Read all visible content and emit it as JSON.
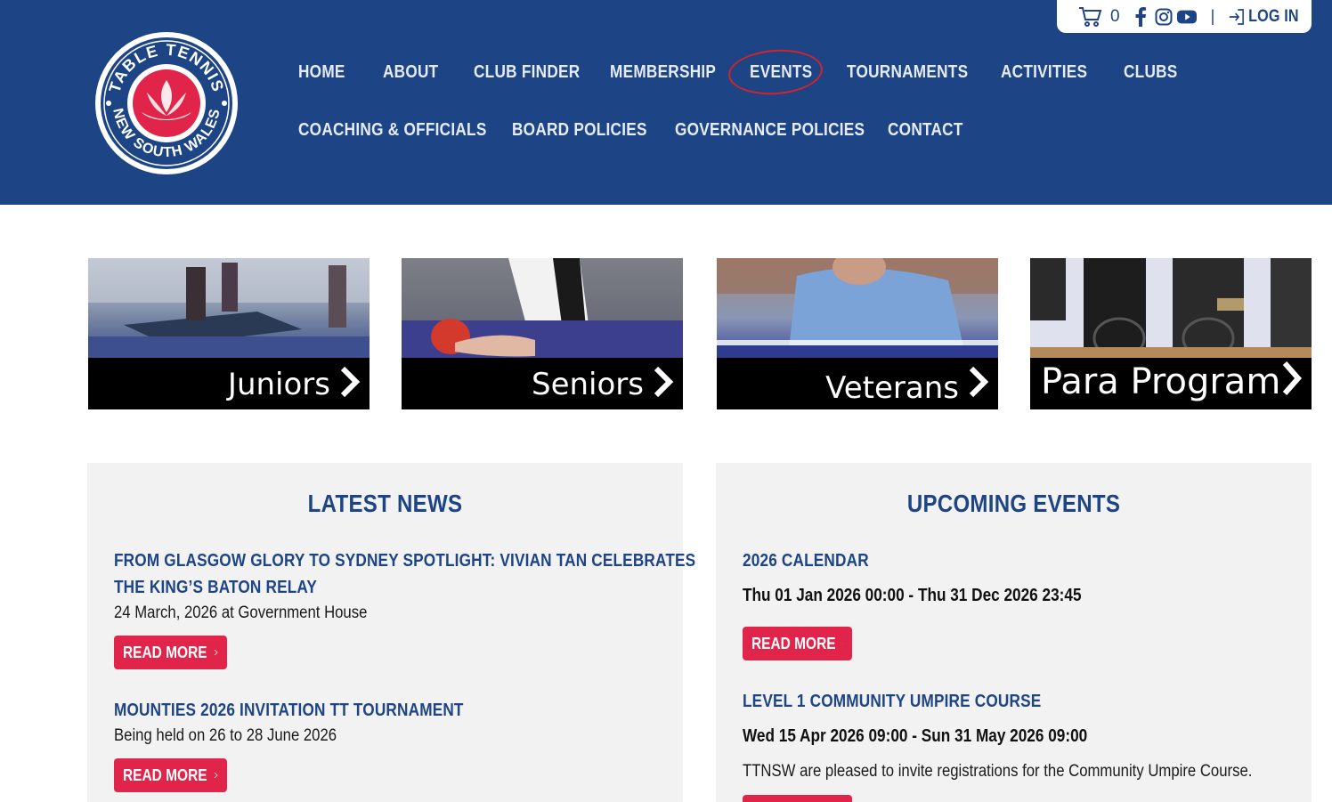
{
  "topbar": {
    "cart_count": "0",
    "separator": "|",
    "login_label": "LOG IN"
  },
  "logo": {
    "text_top": "TABLE TENNIS",
    "text_bottom": "NEW SOUTH WALES"
  },
  "nav": {
    "row1": [
      "HOME",
      "ABOUT",
      "CLUB FINDER",
      "MEMBERSHIP",
      "EVENTS",
      "TOURNAMENTS",
      "ACTIVITIES",
      "CLUBS"
    ],
    "row2": [
      "COACHING & OFFICIALS",
      "BOARD POLICIES",
      "GOVERNANCE POLICIES",
      "CONTACT"
    ]
  },
  "banners": [
    "Juniors",
    "Seniors",
    "Veterans",
    "Para Program"
  ],
  "news": {
    "title": "LATEST NEWS",
    "items": [
      {
        "title_line1": "FROM GLASGOW GLORY TO SYDNEY SPOTLIGHT: VIVIAN TAN CELEBRATES",
        "title_line2": "THE KING’S BATON RELAY",
        "text": "24 March, 2026 at Government House",
        "button": "READ MORE"
      },
      {
        "title_line1": "MOUNTIES 2026 INVITATION TT TOURNAMENT",
        "text": "Being held on 26 to 28 June 2026",
        "button": "READ MORE"
      }
    ]
  },
  "events": {
    "title": "UPCOMING EVENTS",
    "items": [
      {
        "title": "2026 CALENDAR",
        "date": "Thu 01 Jan 2026 00:00 - Thu 31 Dec 2026 23:45",
        "button": "READ MORE"
      },
      {
        "title": "LEVEL 1 COMMUNITY UMPIRE COURSE",
        "date": "Wed 15 Apr 2026 09:00 - Sun 31 May 2026 09:00",
        "text": "TTNSW are pleased to invite registrations for the Community Umpire Course."
      }
    ]
  },
  "colors": {
    "header_bg": "#1d4485",
    "accent_red": "#e1244a",
    "panel_bg": "#f2f2f2"
  }
}
